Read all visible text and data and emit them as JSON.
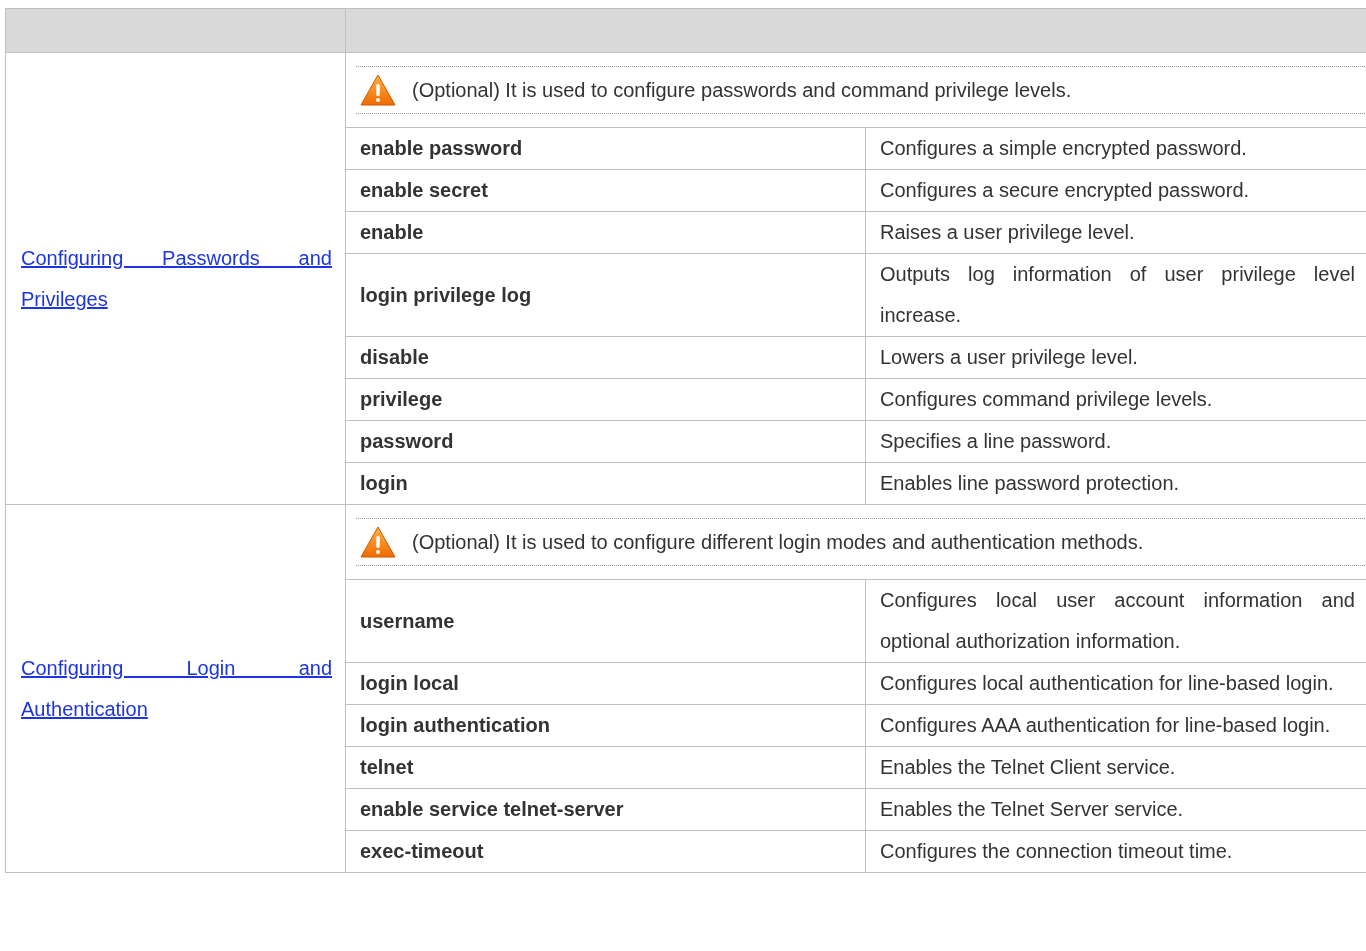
{
  "sections": [
    {
      "title": "Configuring Passwords and Privileges",
      "note": "(Optional) It is used to configure passwords and command privilege levels.",
      "commands": [
        {
          "command": "enable password",
          "description": "Configures a simple encrypted password."
        },
        {
          "command": "enable secret",
          "description": "Configures a secure encrypted password."
        },
        {
          "command": "enable",
          "description": "Raises a user privilege level."
        },
        {
          "command": "login privilege log",
          "description": "Outputs log information of user privilege level increase."
        },
        {
          "command": "disable",
          "description": "Lowers a user privilege level."
        },
        {
          "command": "privilege",
          "description": "Configures command privilege levels."
        },
        {
          "command": "password",
          "description": "Specifies a line password."
        },
        {
          "command": "login",
          "description": "Enables line password protection."
        }
      ]
    },
    {
      "title": "Configuring Login and Authentication",
      "note": "(Optional) It is used to configure different login modes and authentication methods.",
      "commands": [
        {
          "command": "username",
          "description": "Configures local user account information and optional authorization information."
        },
        {
          "command": "login local",
          "description": "Configures local authentication for line-based login."
        },
        {
          "command": "login authentication",
          "description": "Configures AAA authentication for line-based login."
        },
        {
          "command": "telnet",
          "description": "Enables the Telnet Client service."
        },
        {
          "command": "enable service telnet-server",
          "description": "Enables the Telnet Server service."
        },
        {
          "command": "exec-timeout",
          "description": "Configures the connection timeout time."
        }
      ]
    }
  ]
}
